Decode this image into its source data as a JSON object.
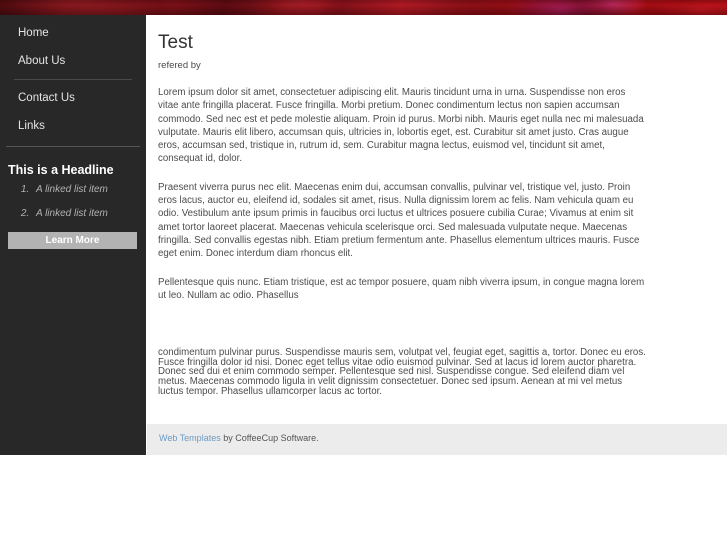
{
  "banner": {
    "accent_color": "#c21118",
    "highlight_color": "#e22878",
    "alt_text": "red abstract texture banner"
  },
  "sidebar": {
    "background_color": "#282828",
    "nav": [
      {
        "label": "Home"
      },
      {
        "label": "About Us"
      },
      {
        "label": "Contact Us"
      },
      {
        "label": "Links"
      }
    ],
    "headline": "This is a Headline",
    "list_items": [
      {
        "label": "A linked list item"
      },
      {
        "label": "A linked list item"
      }
    ],
    "button_label": "Learn More",
    "button_color": "#b3b3b3"
  },
  "main": {
    "title": "Test",
    "subtitle": "refered by",
    "paragraphs": [
      "Lorem ipsum dolor sit amet, consectetuer adipiscing elit. Mauris tincidunt urna in urna. Suspendisse non eros vitae ante fringilla placerat. Fusce fringilla. Morbi pretium. Donec condimentum lectus non sapien accumsan commodo. Sed nec est et pede molestie aliquam. Proin id purus. Morbi nibh. Mauris eget nulla nec mi malesuada vulputate. Mauris elit libero, accumsan quis, ultricies in, lobortis eget, est. Curabitur sit amet justo. Cras augue eros, accumsan sed, tristique in, rutrum id, sem. Curabitur magna lectus, euismod vel, tincidunt sit amet, consequat id, dolor.",
      "Praesent viverra purus nec elit. Maecenas enim dui, accumsan convallis, pulvinar vel, tristique vel, justo. Proin eros lacus, auctor eu, eleifend id, sodales sit amet, risus. Nulla dignissim lorem ac felis. Nam vehicula quam eu odio. Vestibulum ante ipsum primis in faucibus orci luctus et ultrices posuere cubilia Curae; Vivamus at enim sit amet tortor laoreet placerat. Maecenas vehicula scelerisque orci. Sed malesuada vulputate neque. Maecenas fringilla. Sed convallis egestas nibh. Etiam pretium fermentum ante. Phasellus elementum ultrices mauris. Fusce eget enim. Donec interdum diam rhoncus elit.",
      "Pellentesque quis nunc. Etiam tristique, est ac tempor posuere, quam nibh viverra ipsum, in congue magna lorem ut leo. Nullam ac odio. Phasellus",
      "condimentum pulvinar purus. Suspendisse mauris sem, volutpat vel, feugiat eget, sagittis a, tortor. Donec eu eros. Fusce fringilla dolor id nisi. Donec eget tellus vitae odio euismod pulvinar. Sed at lacus id lorem auctor pharetra. Donec sed dui et enim commodo semper. Pellentesque sed nisl. Suspendisse congue. Sed eleifend diam vel metus. Maecenas commodo ligula in velit dignissim consectetuer. Donec sed ipsum. Aenean at mi vel metus luctus tempor. Phasellus ullamcorper lacus ac tortor."
    ]
  },
  "footer": {
    "link_label": "Web Templates",
    "suffix": " by CoffeeCup Software.",
    "link_color": "#6b9bc3",
    "background_color": "#ececec"
  }
}
